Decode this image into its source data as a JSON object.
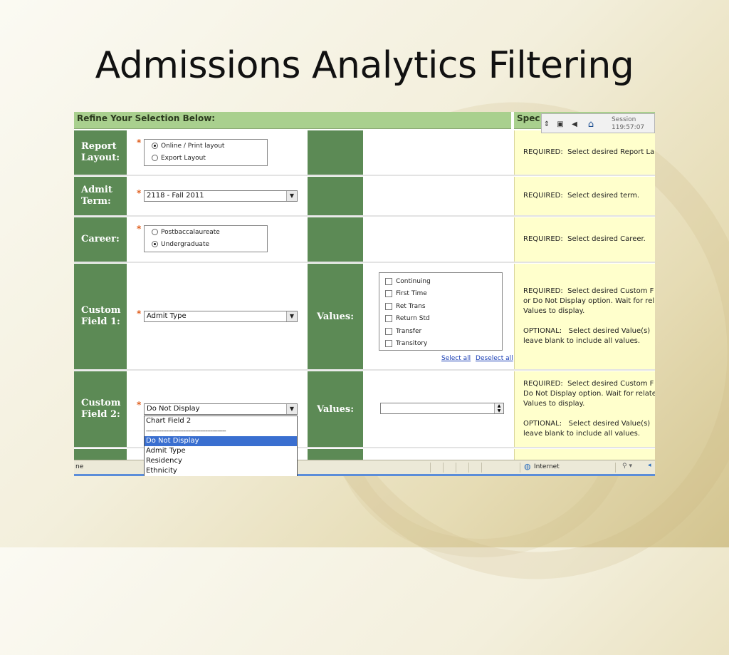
{
  "slide": {
    "title": "Admissions Analytics Filtering"
  },
  "header": {
    "left": "Refine Your Selection Below:",
    "right": "Spec"
  },
  "toolbar": {
    "session_label": "Session",
    "session_time": "119:57:07"
  },
  "rows": {
    "report_layout": {
      "label": "Report Layout:",
      "options": [
        "Online / Print layout",
        "Export Layout"
      ],
      "selected": "Online / Print layout",
      "help": "REQUIRED:  Select desired Report La"
    },
    "admit_term": {
      "label": "Admit Term:",
      "value": "2118 - Fall 2011",
      "help": "REQUIRED:  Select desired term."
    },
    "career": {
      "label": "Career:",
      "options": [
        "Postbaccalaureate",
        "Undergraduate"
      ],
      "selected": "Undergraduate",
      "help": "REQUIRED:  Select desired Career."
    },
    "custom_field_1": {
      "label": "Custom Field 1:",
      "value": "Admit Type",
      "values_label": "Values:",
      "checkboxes": [
        "Continuing",
        "First Time",
        "Ret Trans",
        "Return Std",
        "Transfer",
        "Transitory"
      ],
      "select_all": "Select all",
      "deselect_all": "Deselect all",
      "help": "REQUIRED:  Select desired Custom F\nor Do Not Display option. Wait for rel\nValues to display.\n\nOPTIONAL:   Select desired Value(s)\nleave blank to include all values."
    },
    "custom_field_2": {
      "label": "Custom Field 2:",
      "value": "Do Not Display",
      "values_label": "Values:",
      "help": "REQUIRED:  Select desired Custom F\nDo Not Display option. Wait for relate\nValues to display.\n\nOPTIONAL:   Select desired Value(s)\nleave blank to include all values."
    }
  },
  "dropdown": {
    "items": [
      "Chart Field 2",
      "-----------------------------------------------",
      "Do Not Display",
      "Admit Type",
      "Residency",
      "Ethnicity"
    ],
    "selected": "Do Not Display"
  },
  "statusbar": {
    "left": "ne",
    "zone": "Internet"
  },
  "colors": {
    "label_green": "#5c8a55",
    "header_green": "#a9d08e",
    "help_yellow": "#ffffcc",
    "required_star": "#e06020",
    "link_blue": "#1a3fb5",
    "selection_blue": "#3a6fd0"
  }
}
